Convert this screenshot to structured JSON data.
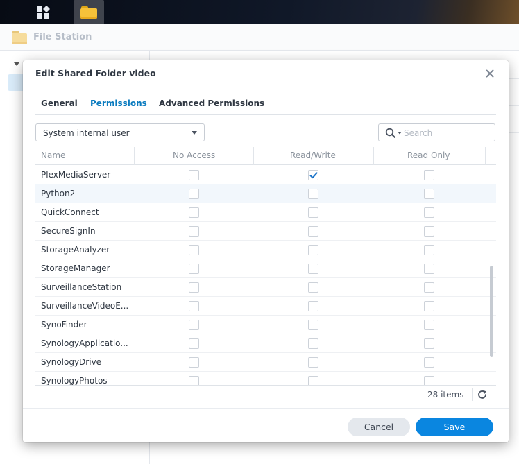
{
  "app": {
    "window_title": "File Station"
  },
  "dialog": {
    "title": "Edit Shared Folder video",
    "tabs": [
      {
        "label": "General",
        "active": false
      },
      {
        "label": "Permissions",
        "active": true
      },
      {
        "label": "Advanced Permissions",
        "active": false
      }
    ],
    "user_type_select": {
      "value": "System internal user"
    },
    "search": {
      "placeholder": "Search",
      "value": ""
    },
    "table": {
      "columns": [
        "Name",
        "No Access",
        "Read/Write",
        "Read Only"
      ],
      "rows": [
        {
          "name": "PlexMediaServer",
          "no_access": false,
          "read_write": true,
          "read_only": false
        },
        {
          "name": "Python2",
          "no_access": false,
          "read_write": false,
          "read_only": false
        },
        {
          "name": "QuickConnect",
          "no_access": false,
          "read_write": false,
          "read_only": false
        },
        {
          "name": "SecureSignIn",
          "no_access": false,
          "read_write": false,
          "read_only": false
        },
        {
          "name": "StorageAnalyzer",
          "no_access": false,
          "read_write": false,
          "read_only": false
        },
        {
          "name": "StorageManager",
          "no_access": false,
          "read_write": false,
          "read_only": false
        },
        {
          "name": "SurveillanceStation",
          "no_access": false,
          "read_write": false,
          "read_only": false
        },
        {
          "name": "SurveillanceVideoE...",
          "no_access": false,
          "read_write": false,
          "read_only": false
        },
        {
          "name": "SynoFinder",
          "no_access": false,
          "read_write": false,
          "read_only": false
        },
        {
          "name": "SynologyApplicatio...",
          "no_access": false,
          "read_write": false,
          "read_only": false
        },
        {
          "name": "SynologyDrive",
          "no_access": false,
          "read_write": false,
          "read_only": false
        },
        {
          "name": "SynologyPhotos",
          "no_access": false,
          "read_write": false,
          "read_only": false
        }
      ]
    },
    "footer": {
      "items_count": "28 items"
    },
    "buttons": {
      "cancel": "Cancel",
      "save": "Save"
    }
  },
  "icons": {
    "main_menu": "grid-icon",
    "file_station": "folder-icon",
    "close": "close-icon",
    "search": "search-icon",
    "refresh": "refresh-icon",
    "check": "check-icon"
  },
  "colors": {
    "accent": "#0a86e0",
    "active_tab": "#0a7bbf",
    "check": "#1a73c8"
  }
}
